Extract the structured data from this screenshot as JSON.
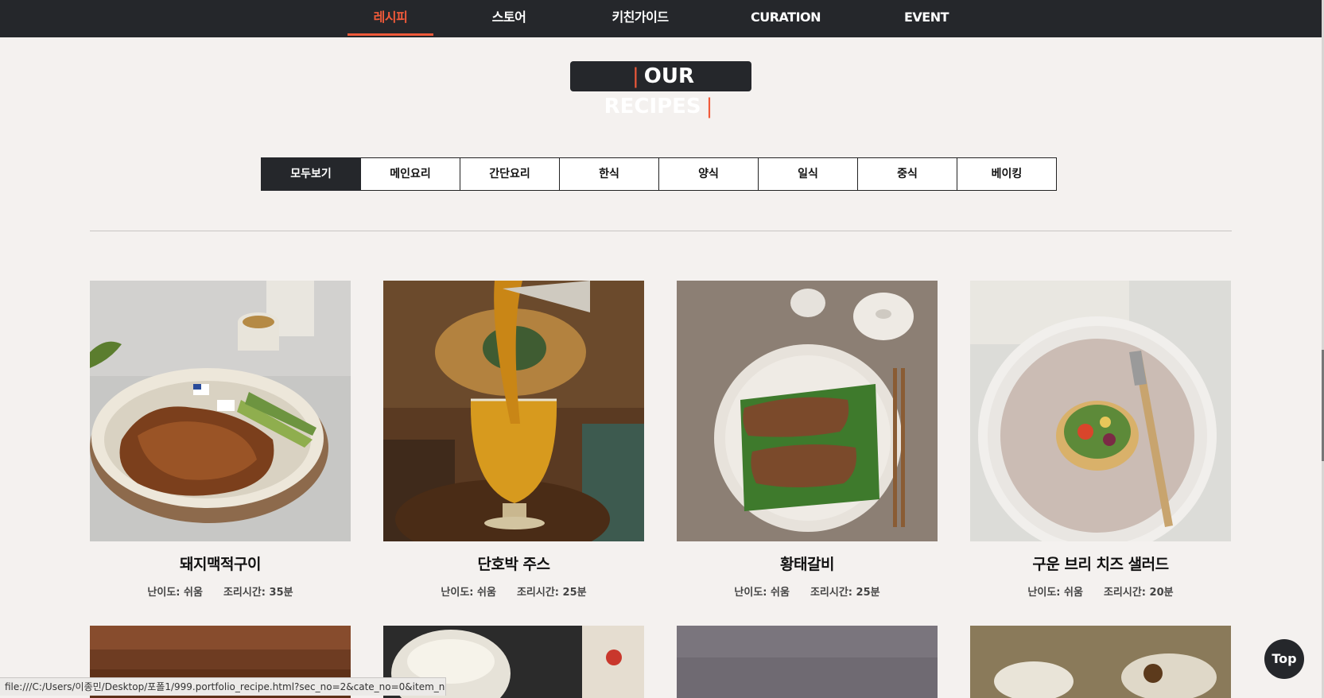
{
  "nav": {
    "items": [
      {
        "label": "레시피",
        "active": true
      },
      {
        "label": "스토어"
      },
      {
        "label": "키친가이드"
      },
      {
        "label": "CURATION"
      },
      {
        "label": "EVENT"
      }
    ]
  },
  "section_title": "OUR RECIPES",
  "categories": [
    {
      "label": "모두보기",
      "active": true
    },
    {
      "label": "메인요리"
    },
    {
      "label": "간단요리"
    },
    {
      "label": "한식"
    },
    {
      "label": "양식"
    },
    {
      "label": "일식"
    },
    {
      "label": "중식"
    },
    {
      "label": "베이킹"
    }
  ],
  "recipes": [
    {
      "name": "돼지맥적구이",
      "difficulty": "난이도: 쉬움",
      "time": "조리시간: 35분",
      "icon": "pork-dish-photo"
    },
    {
      "name": "단호박 주스",
      "difficulty": "난이도: 쉬움",
      "time": "조리시간: 25분",
      "icon": "pumpkin-juice-photo"
    },
    {
      "name": "황태갈비",
      "difficulty": "난이도: 쉬움",
      "time": "조리시간: 25분",
      "icon": "pollack-galbi-photo"
    },
    {
      "name": "구운 브리 치즈 샐러드",
      "difficulty": "난이도: 쉬움",
      "time": "조리시간: 20분",
      "icon": "brie-salad-photo"
    }
  ],
  "status_url": "file:///C:/Users/이종민/Desktop/포폴1/999.portfolio_recipe.html?sec_no=2&cate_no=0&item_n...",
  "top_button": "Top",
  "colors": {
    "dark": "#25272b",
    "accent": "#f05a3a",
    "bg": "#f4f1ef"
  }
}
